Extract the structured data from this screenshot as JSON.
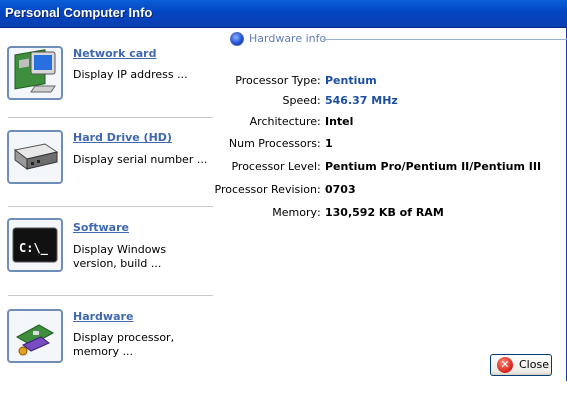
{
  "window": {
    "title": "Personal Computer Info"
  },
  "nav": {
    "items": [
      {
        "label": "Network card",
        "description": "Display IP address ..."
      },
      {
        "label": "Hard Drive (HD)",
        "description": "Display serial number ..."
      },
      {
        "label": "Software",
        "description": "Display Windows version, build ..."
      },
      {
        "label": "Hardware",
        "description": "Display processor, memory ..."
      }
    ]
  },
  "hardware_info": {
    "header": "Hardware info",
    "rows": [
      {
        "key": "Processor Type",
        "value": "Pentium"
      },
      {
        "key": "Speed",
        "value": "546.37 MHz"
      },
      {
        "key": "Architecture",
        "value": "Intel"
      },
      {
        "key": "Num Processors",
        "value": "1"
      },
      {
        "key": "Processor Level",
        "value": "Pentium Pro/Pentium II/Pentium III"
      },
      {
        "key": "Processor Revision",
        "value": "0703"
      },
      {
        "key": "Memory",
        "value": "130,592 KB of RAM"
      }
    ],
    "separator": ":"
  },
  "buttons": {
    "close_label": "Close"
  }
}
